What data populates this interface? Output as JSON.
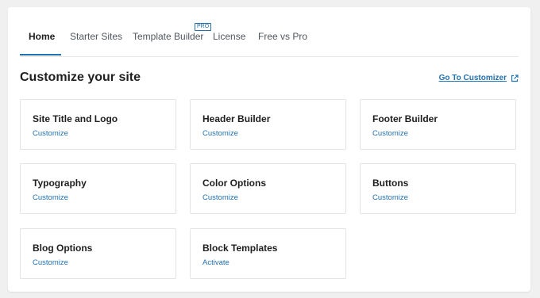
{
  "tabs": [
    {
      "label": "Home",
      "active": true
    },
    {
      "label": "Starter Sites",
      "active": false
    },
    {
      "label": "Template Builder",
      "active": false,
      "badge": "PRO"
    },
    {
      "label": "License",
      "active": false
    },
    {
      "label": "Free vs Pro",
      "active": false
    }
  ],
  "section": {
    "title": "Customize your site",
    "link_label": "Go To Customizer",
    "link_icon": "external-link-icon"
  },
  "cards": [
    {
      "title": "Site Title and Logo",
      "action": "Customize"
    },
    {
      "title": "Header Builder",
      "action": "Customize"
    },
    {
      "title": "Footer Builder",
      "action": "Customize"
    },
    {
      "title": "Typography",
      "action": "Customize"
    },
    {
      "title": "Color Options",
      "action": "Customize"
    },
    {
      "title": "Buttons",
      "action": "Customize"
    },
    {
      "title": "Blog Options",
      "action": "Customize"
    },
    {
      "title": "Block Templates",
      "action": "Activate"
    }
  ],
  "colors": {
    "accent": "#2271b1",
    "text": "#1e1e1e",
    "muted": "#50575e",
    "background": "#f0f0f1",
    "card_border": "#e2e4e7"
  }
}
